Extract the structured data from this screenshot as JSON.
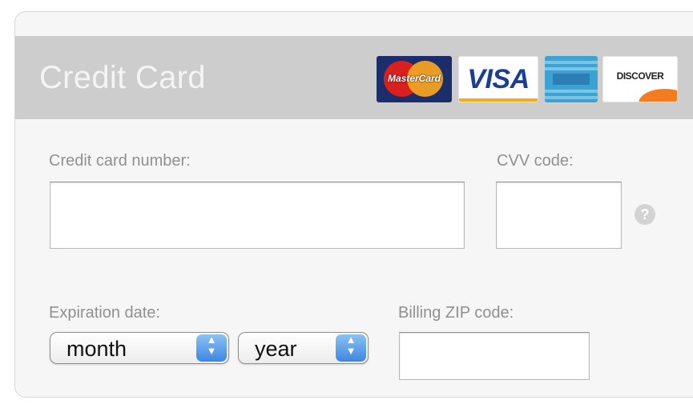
{
  "header": {
    "title": "Credit Card",
    "card_logos": [
      {
        "name": "mastercard-logo",
        "text": "MasterCard"
      },
      {
        "name": "visa-logo",
        "text": "VISA"
      },
      {
        "name": "amex-logo",
        "text": "AMERICAN EXPRESS"
      },
      {
        "name": "discover-logo",
        "text": "DISCOVER"
      }
    ]
  },
  "form": {
    "card_number_label": "Credit card number:",
    "card_number_value": "",
    "cvv_label": "CVV code:",
    "cvv_value": "",
    "help_icon": "question-mark",
    "expiration_label": "Expiration date:",
    "month_select": {
      "selected": "month"
    },
    "year_select": {
      "selected": "year"
    },
    "zip_label": "Billing ZIP code:",
    "zip_value": ""
  },
  "colors": {
    "header_bg": "#cdcdcd",
    "panel_bg": "#f6f6f6",
    "label": "#909090",
    "select_arrow_accent": "#3c86e2"
  }
}
